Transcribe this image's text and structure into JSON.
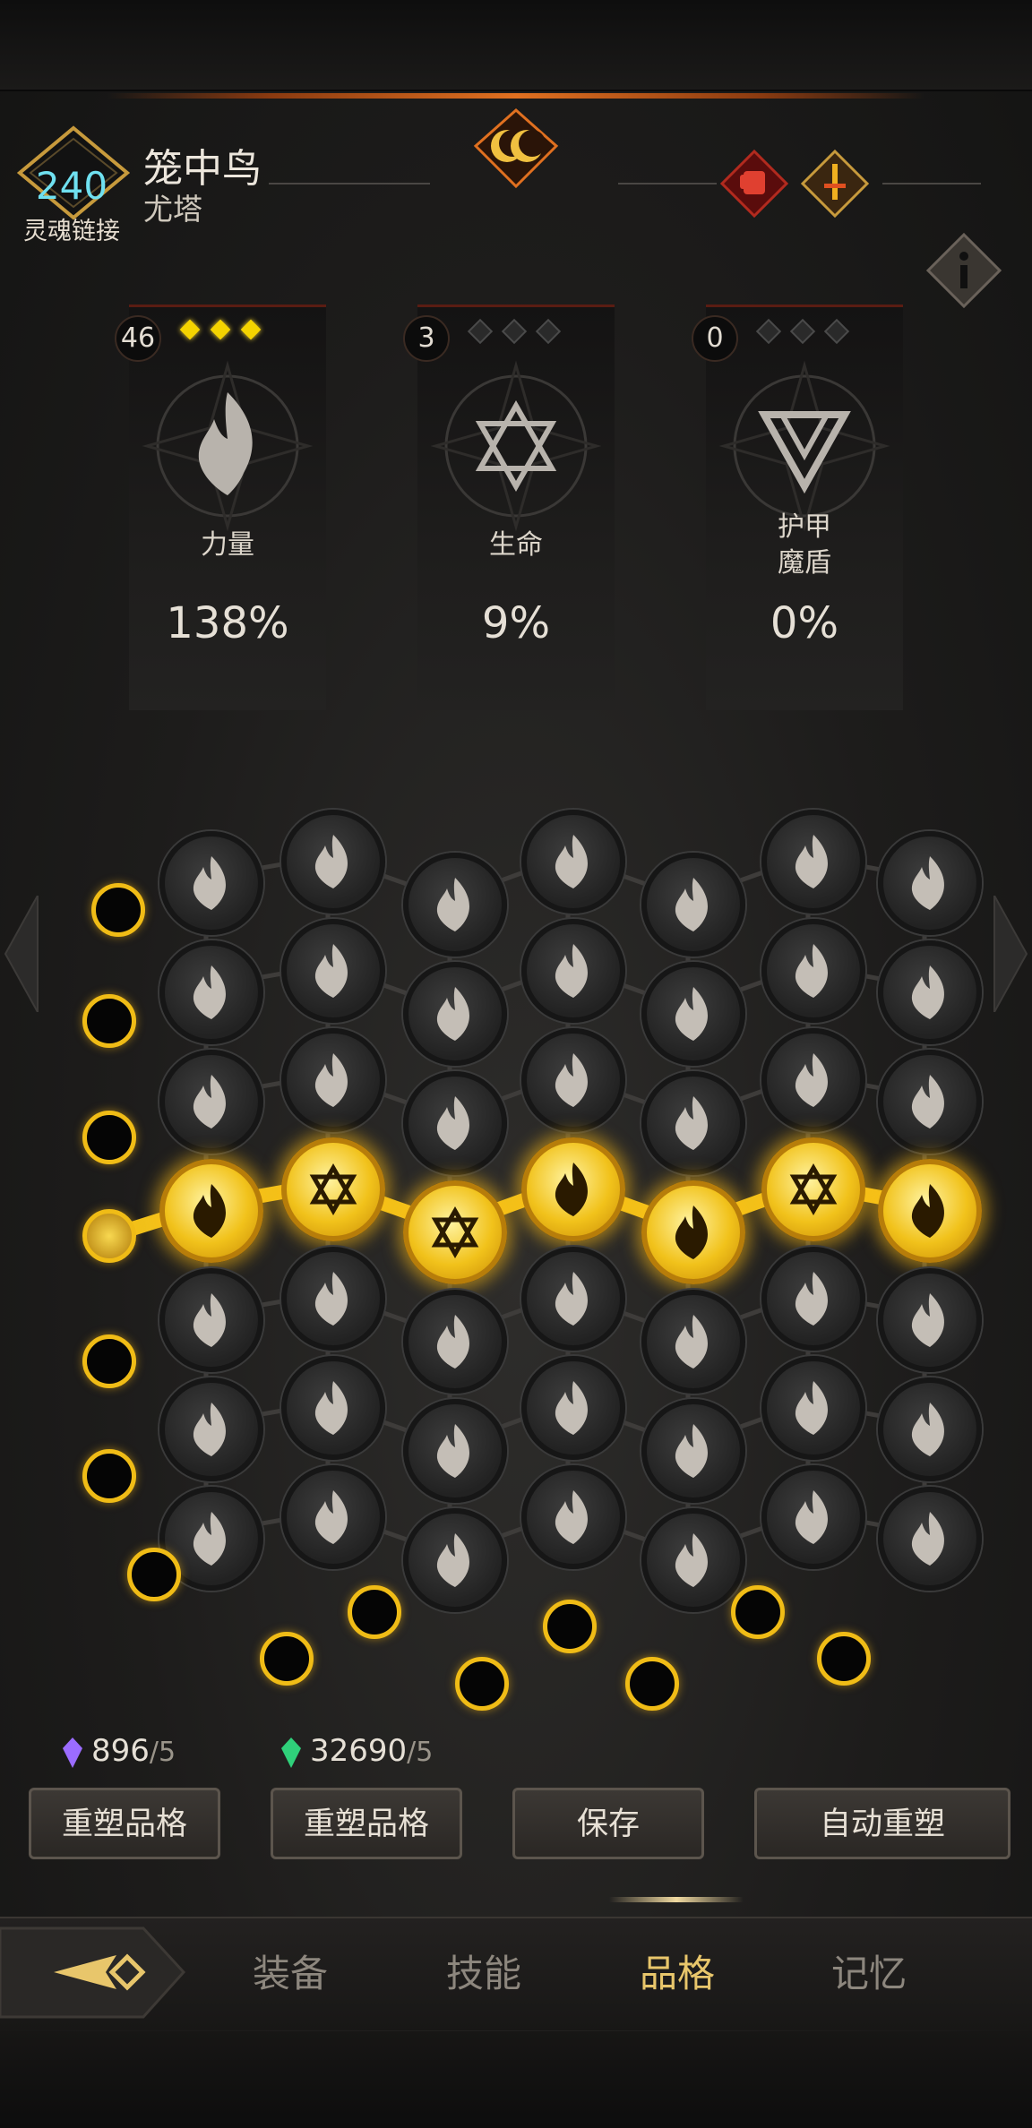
{
  "header": {
    "level": "240",
    "level_label": "灵魂链接",
    "character_name": "笼中鸟",
    "character_sub": "尤塔"
  },
  "stats": [
    {
      "count": "46",
      "gems_active": 3,
      "gems_total": 3,
      "label": "力量",
      "label2": "",
      "value": "138%",
      "icon": "flame-icon"
    },
    {
      "count": "3",
      "gems_active": 0,
      "gems_total": 3,
      "label": "生命",
      "label2": "",
      "value": "9%",
      "icon": "hexagram-icon"
    },
    {
      "count": "0",
      "gems_active": 0,
      "gems_total": 3,
      "label": "护甲",
      "label2": "魔盾",
      "value": "0%",
      "icon": "shield-rune-icon"
    }
  ],
  "board": {
    "rows": [
      [
        "flame",
        "flame",
        "flame",
        "flame",
        "flame",
        "flame",
        "flame"
      ],
      [
        "flame",
        "flame",
        "flame",
        "flame",
        "flame",
        "flame",
        "flame"
      ],
      [
        "flame",
        "flame",
        "flame",
        "flame",
        "flame",
        "flame",
        "flame"
      ],
      [
        "flame",
        "hexagram",
        "hexagram",
        "flame",
        "flame",
        "hexagram",
        "flame"
      ],
      [
        "flame",
        "flame",
        "flame",
        "flame",
        "flame",
        "flame",
        "flame"
      ],
      [
        "flame",
        "flame",
        "flame",
        "flame",
        "flame",
        "flame",
        "flame"
      ],
      [
        "flame",
        "flame",
        "flame",
        "flame",
        "flame",
        "flame",
        "flame"
      ]
    ],
    "active_row": 3
  },
  "resources": {
    "purple_crystal": {
      "amount": "896",
      "max": "/5",
      "color": "#9b6cff"
    },
    "green_crystal": {
      "amount": "32690",
      "max": "/5",
      "color": "#2fd07a"
    }
  },
  "buttons": {
    "reshape1": "重塑品格",
    "reshape2": "重塑品格",
    "save": "保存",
    "auto_reshape": "自动重塑"
  },
  "nav": {
    "tabs": [
      "装备",
      "技能",
      "品格",
      "记忆"
    ],
    "active": "品格"
  },
  "colors": {
    "gold": "#f1c21b",
    "accent": "#e07020",
    "level": "#6fe0f0"
  }
}
